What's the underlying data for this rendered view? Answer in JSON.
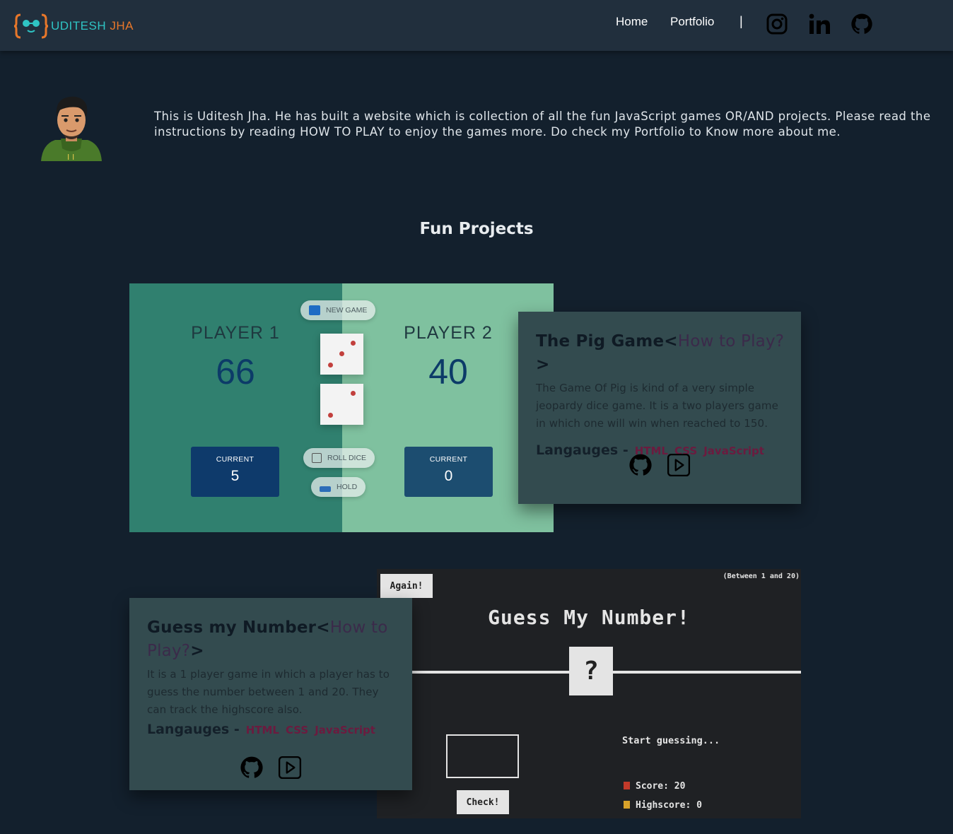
{
  "brand": {
    "first": "UDITESH",
    "last": "JHA"
  },
  "nav": {
    "links": [
      "Home",
      "Portfolio"
    ],
    "separator": "|",
    "social": [
      "instagram-icon",
      "linkedin-icon",
      "github-icon"
    ]
  },
  "intro": {
    "text": "This is Uditesh Jha. He has built a website which is collection of all the fun JavaScript games OR/AND projects. Please read the instructions by reading HOW TO PLAY to enjoy the games more. Do check my Portfolio to Know more about me."
  },
  "section_title": "Fun Projects",
  "pig_preview": {
    "new_game": "NEW GAME",
    "roll_dice": "ROLL DICE",
    "hold": "HOLD",
    "players": [
      {
        "name": "PLAYER 1",
        "score": "66",
        "current_label": "CURRENT",
        "current": "5"
      },
      {
        "name": "PLAYER 2",
        "score": "40",
        "current_label": "CURRENT",
        "current": "0"
      }
    ],
    "colors": {
      "player1_bg": "#30806f",
      "player2_bg": "#7fc19f",
      "score": "#0c3b68",
      "dot": "#c2403d"
    }
  },
  "pig_card": {
    "title": "The Pig Game",
    "lt": "<",
    "how": "How to Play?",
    "gt": ">",
    "description": "The Game Of Pig is kind of a very simple jeopardy dice game. It is a two players game in which one will win when reached to 150.",
    "languages_label": "Langauges -",
    "languages": [
      "HTML",
      "CSS",
      "JavaScript"
    ],
    "links": [
      "github-icon",
      "play-icon"
    ]
  },
  "guess_card": {
    "title": "Guess my Number",
    "lt": "<",
    "how": "How to Play?",
    "gt": ">",
    "description": "It is a 1 player game in which a player has to guess the number between 1 and 20. They can track the highscore also.",
    "languages_label": "Langauges -",
    "languages": [
      "HTML",
      "CSS",
      "JavaScript"
    ],
    "links": [
      "github-icon",
      "play-icon"
    ]
  },
  "guess_preview": {
    "again": "Again!",
    "range": "(Between 1 and 20)",
    "title": "Guess My Number!",
    "number": "?",
    "check": "Check!",
    "message": "Start guessing...",
    "score_label": "Score: ",
    "score": "20",
    "highscore_label": "Highscore: ",
    "highscore": "0"
  }
}
